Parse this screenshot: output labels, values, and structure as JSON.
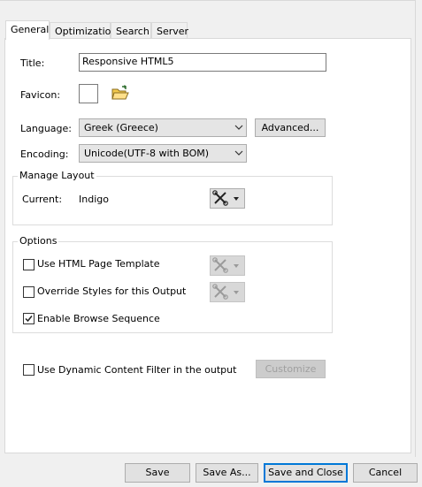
{
  "tabs": [
    {
      "label": "General",
      "active": true
    },
    {
      "label": "Optimization",
      "active": false
    },
    {
      "label": "Search",
      "active": false
    },
    {
      "label": "Server",
      "active": false
    }
  ],
  "general": {
    "title_label": "Title:",
    "title_value": "Responsive HTML5",
    "favicon_label": "Favicon:",
    "language_label": "Language:",
    "language_value": "Greek (Greece)",
    "advanced_button": "Advanced...",
    "encoding_label": "Encoding:",
    "encoding_value": "Unicode(UTF-8 with BOM)"
  },
  "manage_layout": {
    "group_title": "Manage Layout",
    "current_label": "Current:",
    "current_value": "Indigo"
  },
  "options": {
    "group_title": "Options",
    "items": [
      {
        "label": "Use HTML Page Template",
        "checked": false
      },
      {
        "label": "Override Styles for this Output",
        "checked": false
      },
      {
        "label": "Enable Browse Sequence",
        "checked": true
      }
    ]
  },
  "dynamic_filter": {
    "label": "Use Dynamic Content Filter in the output",
    "checked": false,
    "customize_button": "Customize"
  },
  "footer": {
    "save": "Save",
    "save_as": "Save As...",
    "save_close": "Save and Close",
    "cancel": "Cancel"
  },
  "icons": {
    "favicon_browse": "open-folder-icon",
    "layout_tools": "tools-icon",
    "dropdown": "chevron-down-icon"
  },
  "colors": {
    "primary_button_border": "#0078d7",
    "folder_yellow": "#f2c94c"
  }
}
